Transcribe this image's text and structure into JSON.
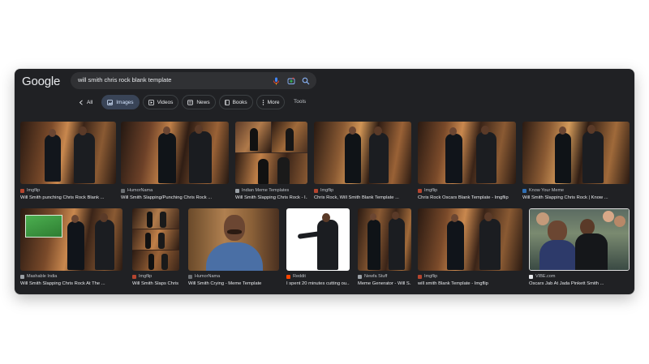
{
  "brand": "Google",
  "search": {
    "query": "will smith chris rock blank template"
  },
  "icons": {
    "mic": "microphone-icon",
    "lens": "camera-lens-icon",
    "search": "search-icon"
  },
  "tabs": [
    {
      "label": "All",
      "icon": "back-arrow-icon",
      "active": false,
      "style": "plain"
    },
    {
      "label": "Images",
      "icon": "image-icon",
      "active": true
    },
    {
      "label": "Videos",
      "icon": "play-icon",
      "active": false
    },
    {
      "label": "News",
      "icon": "newspaper-icon",
      "active": false
    },
    {
      "label": "Books",
      "icon": "book-icon",
      "active": false
    },
    {
      "label": "More",
      "icon": "more-vert-icon",
      "active": false
    }
  ],
  "tools_label": "Tools",
  "results": [
    {
      "source": "Imgflip",
      "title": "Will Smith punching Chris Rock Blank ...",
      "fav_color": "#b5452f"
    },
    {
      "source": "HumorNama",
      "title": "Will Smith Slapping/Punching Chris Rock ...",
      "fav_color": "#6b6f73"
    },
    {
      "source": "Indian Meme Templates",
      "title": "Will Smith Slapping Chris Rock - I...",
      "fav_color": "#9aa0a6"
    },
    {
      "source": "Imgflip",
      "title": "Chris Rock, Will Smith Blank Template ...",
      "fav_color": "#b5452f"
    },
    {
      "source": "Imgflip",
      "title": "Chris Rock Oscars Blank Template - Imgflip",
      "fav_color": "#b5452f"
    },
    {
      "source": "Know Your Meme",
      "title": "Will Smith Slapping Chris Rock | Know ...",
      "fav_color": "#2f6fb5"
    },
    {
      "source": "Mashable India",
      "title": "Will Smith Slapping Chris Rock At The ...",
      "fav_color": "#9aa0a6"
    },
    {
      "source": "Imgflip",
      "title": "Will Smith Slaps Chris ...",
      "fav_color": "#b5452f"
    },
    {
      "source": "HumorNama",
      "title": "Will Smith Crying - Meme Template",
      "fav_color": "#6b6f73"
    },
    {
      "source": "Reddit",
      "title": "I spent 20 minutes cutting ou...",
      "fav_color": "#ff4500"
    },
    {
      "source": "Newfa Stuff",
      "title": "Meme Generator - Will S...",
      "fav_color": "#9aa0a6"
    },
    {
      "source": "Imgflip",
      "title": "will smith Blank Template - Imgflip",
      "fav_color": "#b5452f"
    },
    {
      "source": "VIBE.com",
      "title": "Oscars Jab At Jada Pinkett Smith ...",
      "fav_color": "#e8eaed"
    }
  ],
  "colors": {
    "window_bg": "#202124",
    "search_bg": "#303134",
    "active_tab_bg": "#394457"
  }
}
